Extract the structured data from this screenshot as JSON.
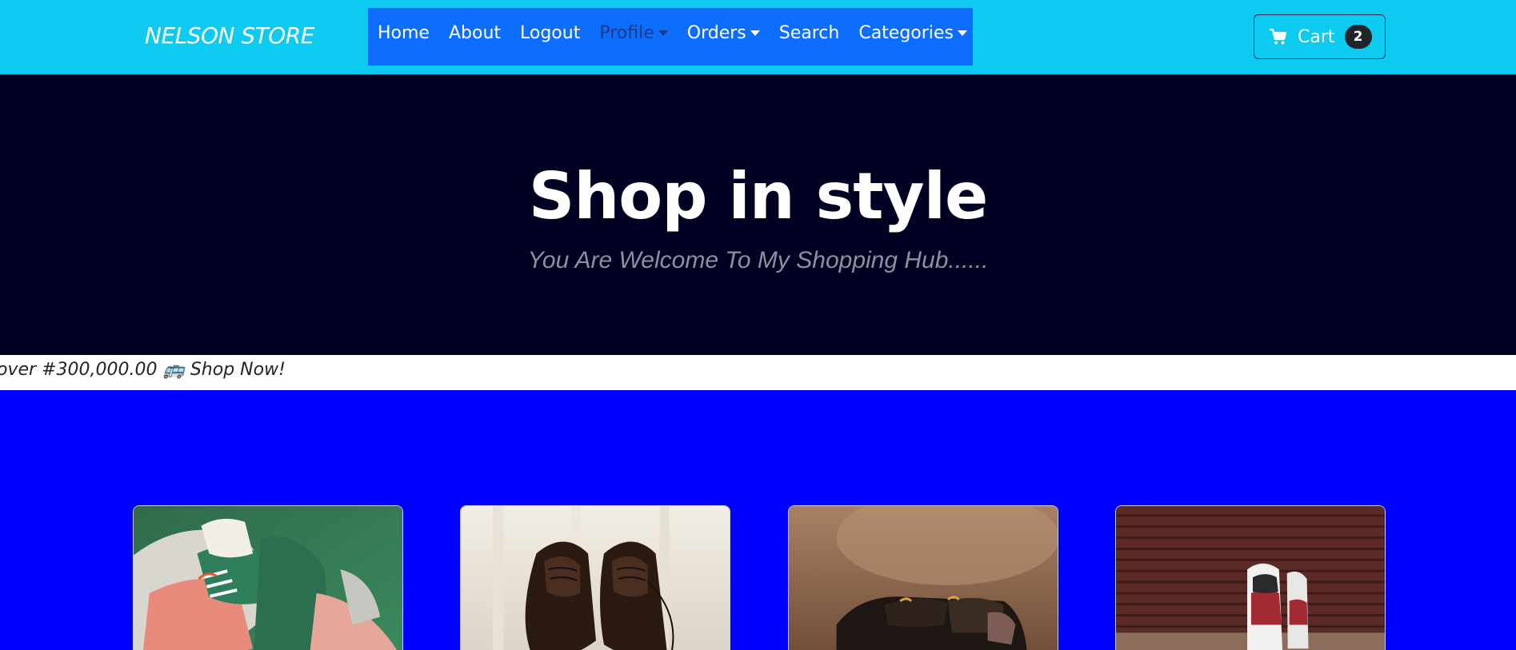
{
  "navbar": {
    "brand": "NELSON STORE",
    "links": [
      {
        "label": "Home",
        "dropdown": false
      },
      {
        "label": "About",
        "dropdown": false
      },
      {
        "label": "Logout",
        "dropdown": false
      },
      {
        "label": "Profile",
        "dropdown": true
      },
      {
        "label": "Orders",
        "dropdown": true
      },
      {
        "label": "Search",
        "dropdown": false
      },
      {
        "label": "Categories",
        "dropdown": true
      }
    ],
    "cart": {
      "label": "Cart",
      "count": "2",
      "icon": "cart-icon"
    }
  },
  "hero": {
    "title": "Shop in style",
    "subtitle": "You Are Welcome To My Shopping Hub......"
  },
  "ticker": {
    "text": "over #300,000.00 🚌 Shop Now!"
  },
  "colors": {
    "navbar_bg": "#0dcaf0",
    "nav_links_bg": "#0d6efd",
    "hero_bg": "#000022",
    "products_bg": "#0000ff"
  },
  "products": [
    {
      "image": "green-pink-sneakers"
    },
    {
      "image": "black-leather-oxford-shoes"
    },
    {
      "image": "black-high-top-sneakers"
    },
    {
      "image": "white-red-sneakers"
    }
  ]
}
